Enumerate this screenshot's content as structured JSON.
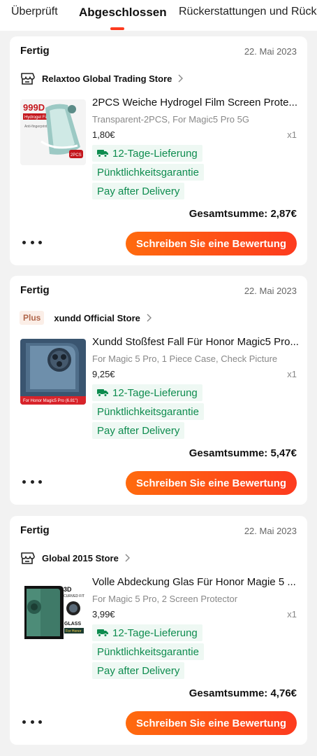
{
  "tabs": {
    "items": [
      {
        "label": "Überprüft"
      },
      {
        "label": "Abgeschlossen",
        "active": true
      },
      {
        "label": "Rückerstattungen und Rückse"
      }
    ],
    "accent": "#fd3b1f"
  },
  "orders": [
    {
      "status": "Fertig",
      "date": "22. Mai 2023",
      "store": {
        "name": "Relaxtoo Global Trading Store",
        "icon": "store-icon"
      },
      "product": {
        "title": "2PCS Weiche Hydrogel Film Screen Prote...",
        "variant": "Transparent-2PCS, For Magic5 Pro 5G",
        "price": "1,80€",
        "qty": "x1",
        "image_text": {
          "brand": "999D",
          "sub": "Hydrogel Film",
          "note": "Anti-fingerprint",
          "count": "2PCS"
        }
      },
      "tags": {
        "delivery": "12-Tage-Lieferung",
        "punctuality": "Pünktlichkeitsgarantie",
        "payment": "Pay after Delivery"
      },
      "total": "Gesamtsumme: 2,87€",
      "review_label": "Schreiben Sie eine Bewertung"
    },
    {
      "status": "Fertig",
      "date": "22. Mai 2023",
      "store": {
        "name": "xundd Official Store",
        "badge": "Plus"
      },
      "product": {
        "title": "Xundd Stoßfest Fall Für Honor Magic5 Pro...",
        "variant": "For Magic 5 Pro, 1 Piece Case, Check Picture",
        "price": "9,25€",
        "qty": "x1",
        "image_text": {
          "caption": "For Honor Magic5 Pro (6.81\")"
        }
      },
      "tags": {
        "delivery": "12-Tage-Lieferung",
        "punctuality": "Pünktlichkeitsgarantie",
        "payment": "Pay after Delivery"
      },
      "total": "Gesamtsumme: 5,47€",
      "review_label": "Schreiben Sie eine Bewertung"
    },
    {
      "status": "Fertig",
      "date": "22. Mai 2023",
      "store": {
        "name": "Global 2015 Store",
        "icon": "store-icon"
      },
      "product": {
        "title": "Volle Abdeckung Glas Für Honor Magie 5 ...",
        "variant": "For Magic 5 Pro, 2 Screen Protector",
        "price": "3,99€",
        "qty": "x1",
        "image_text": {
          "line1": "3D",
          "line2": "CURVED FIT",
          "line3": "GLASS",
          "line4": "For Honor"
        }
      },
      "tags": {
        "delivery": "12-Tage-Lieferung",
        "punctuality": "Pünktlichkeitsgarantie",
        "payment": "Pay after Delivery"
      },
      "total": "Gesamtsumme: 4,76€",
      "review_label": "Schreiben Sie eine Bewertung"
    }
  ],
  "colors": {
    "accent": "#fd3b1f",
    "tag_green": "#0e8c4f",
    "tag_bg": "#eef8f3"
  }
}
